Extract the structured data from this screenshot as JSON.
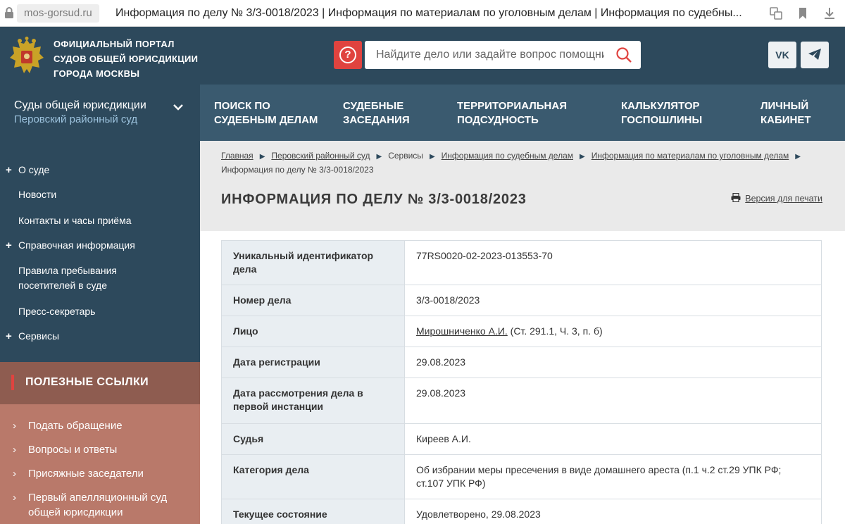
{
  "browser": {
    "url": "mos-gorsud.ru",
    "title": "Информация по делу № 3/3-0018/2023 | Информация по материалам по уголовным делам | Информация по судебны..."
  },
  "header": {
    "portal_line1": "Официальный портал",
    "portal_line2": "судов общей юрисдикции",
    "portal_line3": "города Москвы",
    "help_label": "?",
    "search_placeholder": "Найдите дело или задайте вопрос помощнику",
    "vk_label": "VK",
    "colors": {
      "header_bg": "#2d495c",
      "nav_bg": "#3a5a6f",
      "accent": "#e0433f"
    }
  },
  "court_selector": {
    "line1": "Суды общей юрисдикции",
    "line2": "Перовский районный суд"
  },
  "topnav": [
    {
      "line1": "Поиск по",
      "line2": "судебным делам"
    },
    {
      "line1": "Судебные",
      "line2": "заседания"
    },
    {
      "line1": "Территориальная",
      "line2": "подсудность"
    },
    {
      "line1": "Калькулятор",
      "line2": "госпошлины"
    },
    {
      "line1": "Личный",
      "line2": "кабинет"
    }
  ],
  "sidebar": {
    "items": [
      {
        "label": "О суде",
        "expandable": true
      },
      {
        "label": "Новости",
        "expandable": false
      },
      {
        "label": "Контакты и часы приёма",
        "expandable": false
      },
      {
        "label": "Справочная информация",
        "expandable": true
      },
      {
        "label": "Правила пребывания посетителей в суде",
        "expandable": false
      },
      {
        "label": "Пресс-секретарь",
        "expandable": false
      },
      {
        "label": "Сервисы",
        "expandable": true
      }
    ]
  },
  "useful_links": {
    "title": "Полезные ссылки",
    "items": [
      "Подать обращение",
      "Вопросы и ответы",
      "Присяжные заседатели",
      "Первый апелляционный суд общей юрисдикции"
    ]
  },
  "breadcrumbs": [
    "Главная",
    "Перовский районный суд",
    "Сервисы",
    "Информация по судебным делам",
    "Информация по материалам по уголовным делам",
    "Информация по делу № 3/3-0018/2023"
  ],
  "page": {
    "title": "Информация по делу № 3/3-0018/2023",
    "print_label": "Версия для печати"
  },
  "case_table": [
    {
      "key": "Уникальный идентификатор дела",
      "value": "77RS0020-02-2023-013553-70"
    },
    {
      "key": "Номер дела",
      "value": "3/3-0018/2023"
    },
    {
      "key": "Лицо",
      "link": "Мирошниченко А.И.",
      "value": " (Ст. 291.1, Ч. 3, п. б)"
    },
    {
      "key": "Дата регистрации",
      "value": "29.08.2023"
    },
    {
      "key": "Дата рассмотрения дела в первой инстанции",
      "value": "29.08.2023"
    },
    {
      "key": "Судья",
      "value": "Киреев А.И."
    },
    {
      "key": "Категория дела",
      "value": "Об избрании меры пресечения в виде домашнего ареста (п.1 ч.2 ст.29 УПК РФ; ст.107 УПК РФ)"
    },
    {
      "key": "Текущее состояние",
      "value": "Удовлетворено, 29.08.2023"
    }
  ]
}
